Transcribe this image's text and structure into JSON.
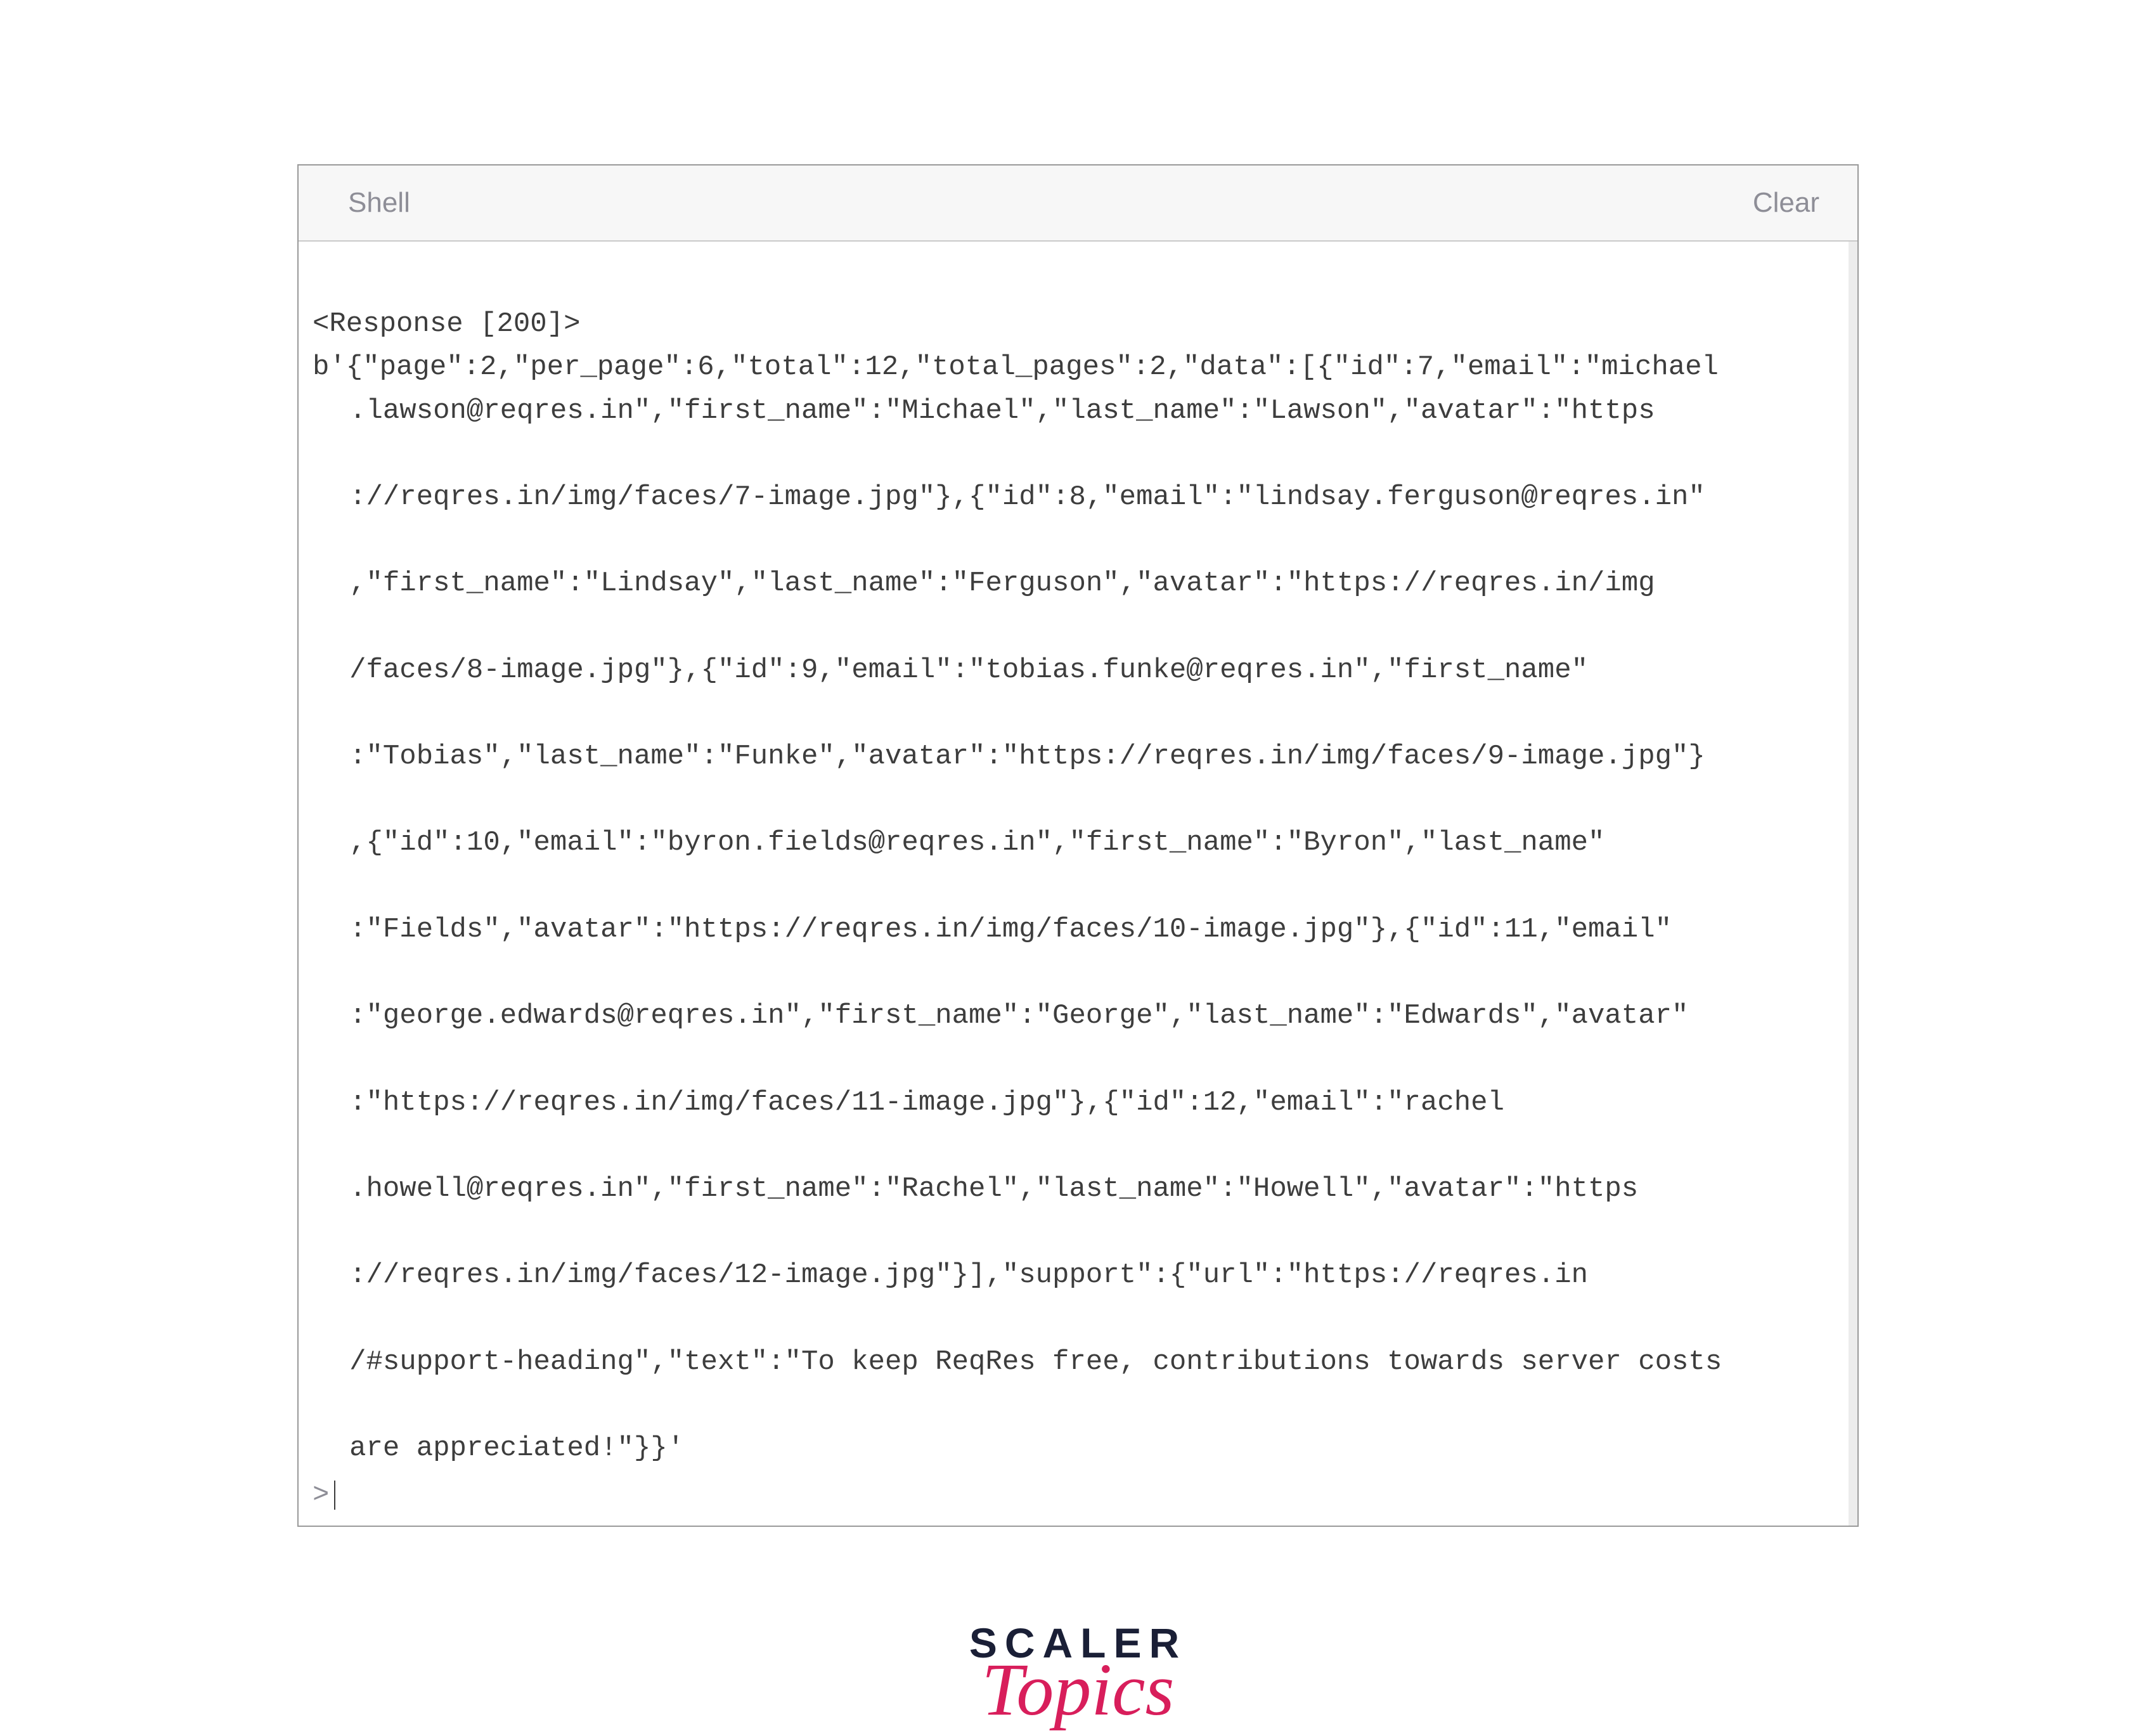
{
  "header": {
    "title": "Shell",
    "clear_label": "Clear"
  },
  "output": {
    "line1": "<Response [200]>",
    "line2_first": "b'{\"page\":2,\"per_page\":6,\"total\":12,\"total_pages\":2,\"data\":[{\"id\":7,\"email\":\"michael",
    "wrapped": [
      ".lawson@reqres.in\",\"first_name\":\"Michael\",\"last_name\":\"Lawson\",\"avatar\":\"https",
      "://reqres.in/img/faces/7-image.jpg\"},{\"id\":8,\"email\":\"lindsay.ferguson@reqres.in\"",
      ",\"first_name\":\"Lindsay\",\"last_name\":\"Ferguson\",\"avatar\":\"https://reqres.in/img",
      "/faces/8-image.jpg\"},{\"id\":9,\"email\":\"tobias.funke@reqres.in\",\"first_name\"",
      ":\"Tobias\",\"last_name\":\"Funke\",\"avatar\":\"https://reqres.in/img/faces/9-image.jpg\"}",
      ",{\"id\":10,\"email\":\"byron.fields@reqres.in\",\"first_name\":\"Byron\",\"last_name\"",
      ":\"Fields\",\"avatar\":\"https://reqres.in/img/faces/10-image.jpg\"},{\"id\":11,\"email\"",
      ":\"george.edwards@reqres.in\",\"first_name\":\"George\",\"last_name\":\"Edwards\",\"avatar\"",
      ":\"https://reqres.in/img/faces/11-image.jpg\"},{\"id\":12,\"email\":\"rachel",
      ".howell@reqres.in\",\"first_name\":\"Rachel\",\"last_name\":\"Howell\",\"avatar\":\"https",
      "://reqres.in/img/faces/12-image.jpg\"}],\"support\":{\"url\":\"https://reqres.in",
      "/#support-heading\",\"text\":\"To keep ReqRes free, contributions towards server costs",
      "are appreciated!\"}}'"
    ]
  },
  "prompt": ">",
  "logo": {
    "word1": "SCALER",
    "word2": "Topics"
  },
  "response_json": {
    "page": 2,
    "per_page": 6,
    "total": 12,
    "total_pages": 2,
    "data": [
      {
        "id": 7,
        "email": "michael.lawson@reqres.in",
        "first_name": "Michael",
        "last_name": "Lawson",
        "avatar": "https://reqres.in/img/faces/7-image.jpg"
      },
      {
        "id": 8,
        "email": "lindsay.ferguson@reqres.in",
        "first_name": "Lindsay",
        "last_name": "Ferguson",
        "avatar": "https://reqres.in/img/faces/8-image.jpg"
      },
      {
        "id": 9,
        "email": "tobias.funke@reqres.in",
        "first_name": "Tobias",
        "last_name": "Funke",
        "avatar": "https://reqres.in/img/faces/9-image.jpg"
      },
      {
        "id": 10,
        "email": "byron.fields@reqres.in",
        "first_name": "Byron",
        "last_name": "Fields",
        "avatar": "https://reqres.in/img/faces/10-image.jpg"
      },
      {
        "id": 11,
        "email": "george.edwards@reqres.in",
        "first_name": "George",
        "last_name": "Edwards",
        "avatar": "https://reqres.in/img/faces/11-image.jpg"
      },
      {
        "id": 12,
        "email": "rachel.howell@reqres.in",
        "first_name": "Rachel",
        "last_name": "Howell",
        "avatar": "https://reqres.in/img/faces/12-image.jpg"
      }
    ],
    "support": {
      "url": "https://reqres.in/#support-heading",
      "text": "To keep ReqRes free, contributions towards server costs are appreciated!"
    }
  }
}
